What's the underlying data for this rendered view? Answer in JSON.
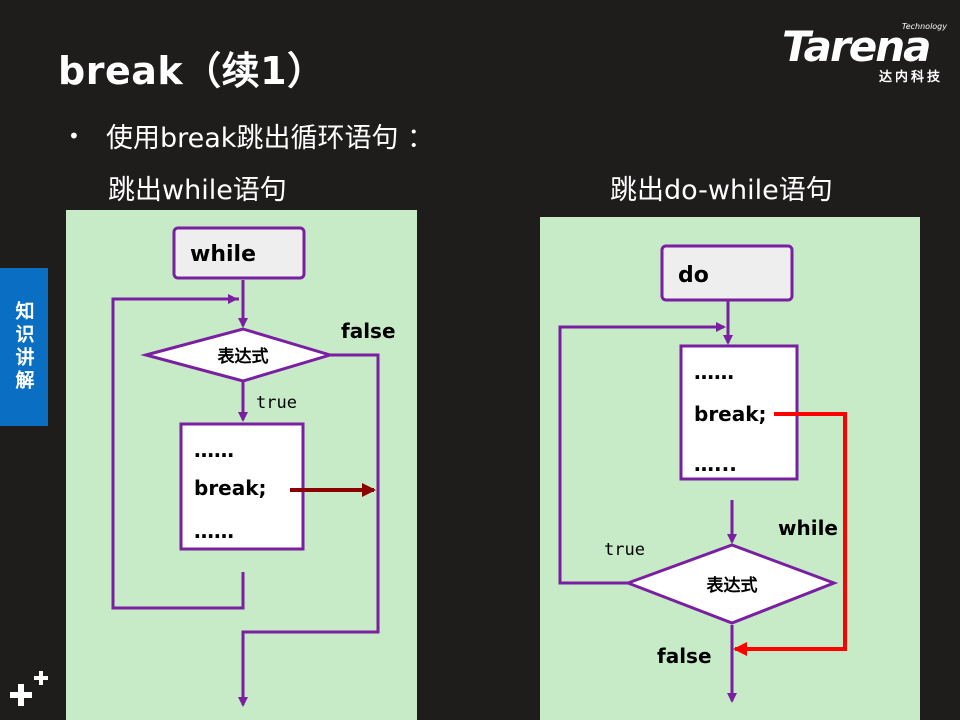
{
  "title": "break（续1）",
  "logo": {
    "small": "Technology",
    "main": "Tarena",
    "cn": "达内科技"
  },
  "side_tab": "知识讲解",
  "bullet": "使用break跳出循环语句 ：",
  "sections": {
    "left": "跳出while语句",
    "right": "跳出do-while语句"
  },
  "diagram_left": {
    "start": "while",
    "condition": "表达式",
    "true_label": "true",
    "false_label": "false",
    "body": [
      "……",
      "break;",
      "……"
    ]
  },
  "diagram_right": {
    "start": "do",
    "body": [
      "……",
      "break;",
      "…..."
    ],
    "condition": "表达式",
    "true_label": "true",
    "loop_label": "while",
    "false_label": "false"
  },
  "colors": {
    "background": "#1f1c1c",
    "panel": "#c6ebc6",
    "flow_line": "#7a1fa2",
    "break_arrow_left": "#8b0000",
    "break_arrow_right": "#ff0000",
    "side_tab": "#0a6fc2"
  }
}
